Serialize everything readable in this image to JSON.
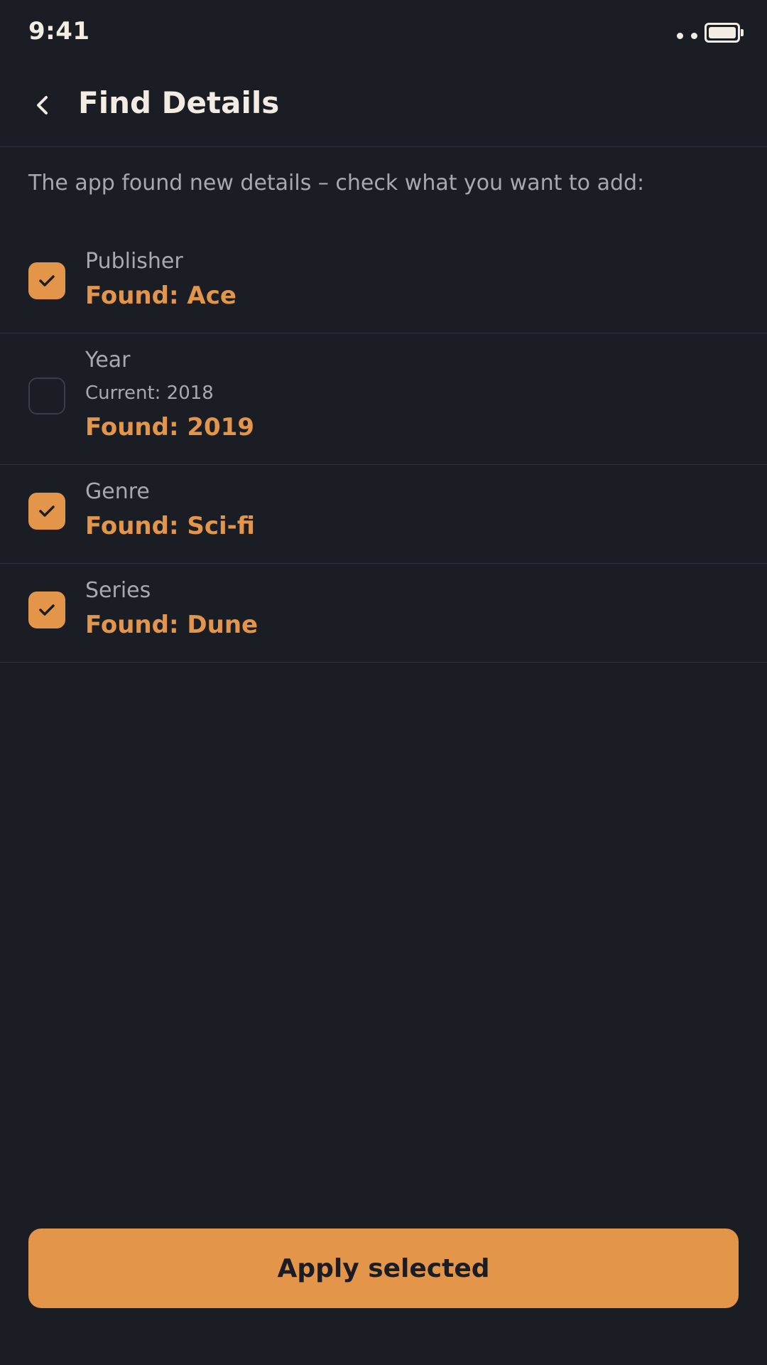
{
  "status_bar": {
    "time": "9:41"
  },
  "header": {
    "title": "Find Details",
    "back_icon": "chevron-left-icon"
  },
  "intro_text": "The app found new details – check what you want to add:",
  "details": [
    {
      "label": "Publisher",
      "current": "",
      "found": "Found: Ace",
      "checked": true
    },
    {
      "label": "Year",
      "current": "Current: 2018",
      "found": "Found: 2019",
      "checked": false
    },
    {
      "label": "Genre",
      "current": "",
      "found": "Found: Sci-fi",
      "checked": true
    },
    {
      "label": "Series",
      "current": "",
      "found": "Found: Dune",
      "checked": true
    }
  ],
  "apply_button_label": "Apply selected",
  "colors": {
    "background": "#1b1d24",
    "accent": "#e3964a",
    "text_primary": "#f3ece2",
    "text_muted": "#a7a9b0",
    "divider": "#2e3139"
  }
}
